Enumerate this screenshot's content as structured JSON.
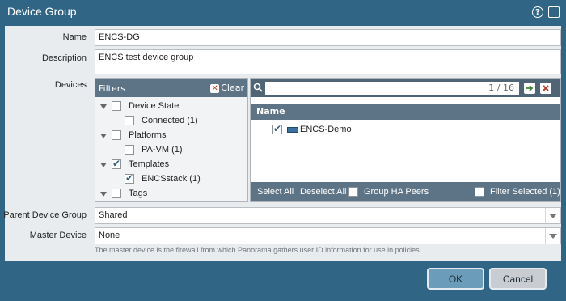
{
  "dialog": {
    "title": "Device Group",
    "help_icon": "help-icon",
    "maximize_icon": "maximize-icon"
  },
  "form": {
    "name_label": "Name",
    "name_value": "ENCS-DG",
    "description_label": "Description",
    "description_value": "ENCS test device group",
    "devices_label": "Devices",
    "parent_label": "Parent Device Group",
    "parent_value": "Shared",
    "master_label": "Master Device",
    "master_value": "None",
    "master_hint": "The master device is the firewall from which Panorama gathers user ID information for use in policies."
  },
  "filters": {
    "title": "Filters",
    "clear_label": "Clear",
    "items": [
      {
        "label": "Device State",
        "level": 0,
        "expanded": true,
        "checked": false
      },
      {
        "label": "Connected (1)",
        "level": 1,
        "checked": false
      },
      {
        "label": "Platforms",
        "level": 0,
        "expanded": true,
        "checked": false
      },
      {
        "label": "PA-VM (1)",
        "level": 1,
        "checked": false
      },
      {
        "label": "Templates",
        "level": 0,
        "expanded": true,
        "checked": true
      },
      {
        "label": "ENCSstack (1)",
        "level": 1,
        "checked": true
      },
      {
        "label": "Tags",
        "level": 0,
        "expanded": false,
        "checked": false
      }
    ]
  },
  "devices": {
    "search_count": "1 / 16",
    "column_name": "Name",
    "rows": [
      {
        "name": "ENCS-Demo",
        "checked": true
      }
    ],
    "select_all": "Select All",
    "deselect_all": "Deselect All",
    "group_ha_peers": "Group HA Peers",
    "filter_selected": "Filter Selected (1)"
  },
  "footer": {
    "ok_label": "OK",
    "cancel_label": "Cancel"
  }
}
